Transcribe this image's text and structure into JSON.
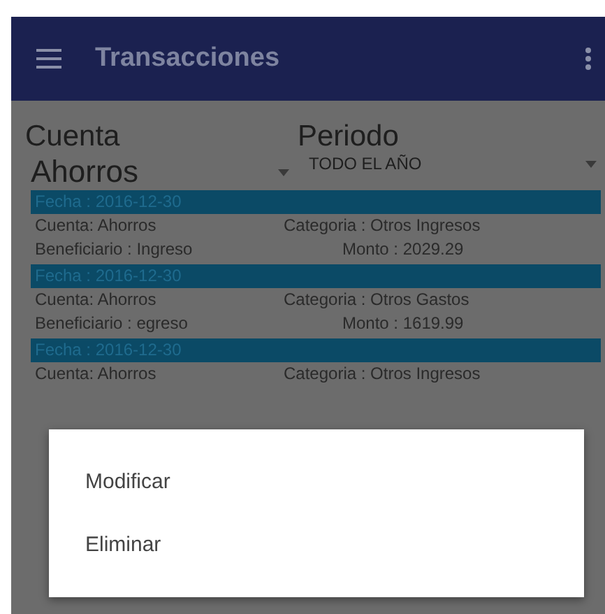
{
  "app_bar": {
    "title": "Transacciones"
  },
  "filters": [
    {
      "label": "Cuenta",
      "value": "Ahorros",
      "kind": "large"
    },
    {
      "label": "Periodo",
      "value": "TODO EL AÑO",
      "kind": "small"
    }
  ],
  "records": [
    {
      "fecha": "Fecha : 2016-12-30",
      "cuenta": "Cuenta: Ahorros",
      "categoria": "Categoria :  Otros Ingresos",
      "beneficiario": "Beneficiario : Ingreso",
      "monto": "Monto :    2029.29"
    },
    {
      "fecha": "Fecha : 2016-12-30",
      "cuenta": "Cuenta: Ahorros",
      "categoria": "Categoria :  Otros Gastos",
      "beneficiario": "Beneficiario : egreso",
      "monto": "Monto :    1619.99"
    },
    {
      "fecha": "Fecha : 2016-12-30",
      "cuenta": "Cuenta: Ahorros",
      "categoria": "Categoria :  Otros Ingresos"
    }
  ],
  "menu": [
    "Modificar",
    "Eliminar"
  ]
}
